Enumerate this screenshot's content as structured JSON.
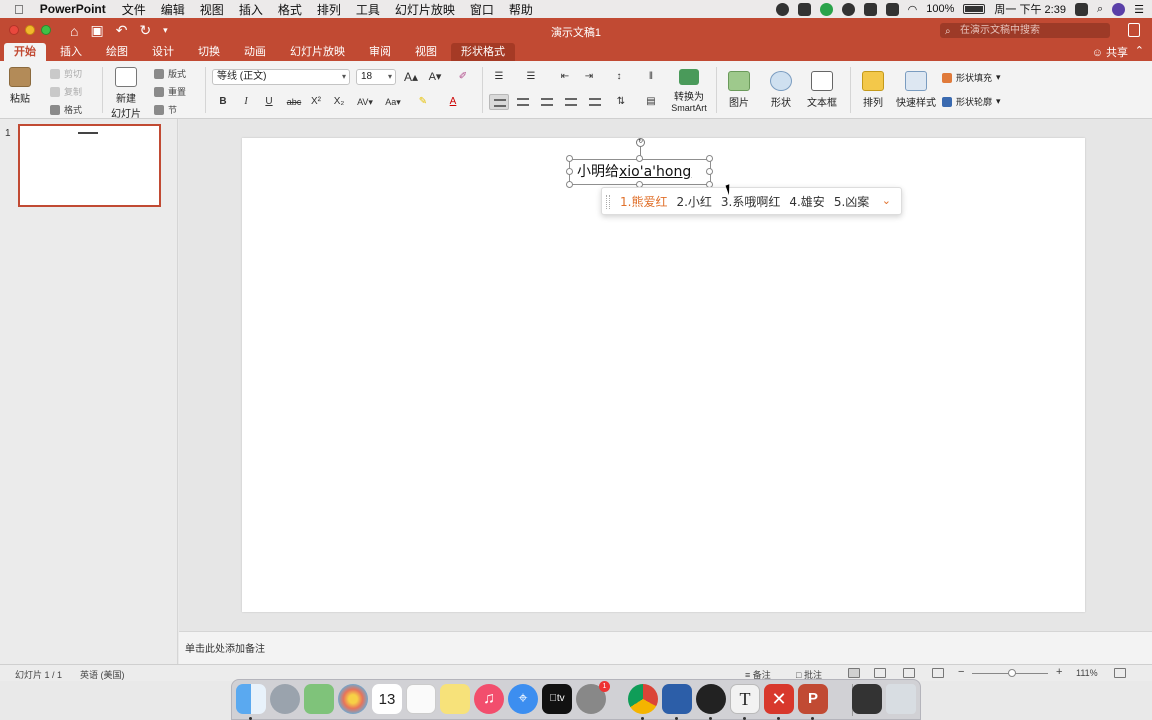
{
  "menubar": {
    "app_name": "PowerPoint",
    "items": [
      "文件",
      "编辑",
      "视图",
      "插入",
      "格式",
      "排列",
      "工具",
      "幻灯片放映",
      "窗口",
      "帮助"
    ],
    "battery": "100%",
    "clock": "周一 下午 2:39"
  },
  "titlebar": {
    "doc_title": "演示文稿1",
    "search_placeholder": "在演示文稿中搜索"
  },
  "tabs": {
    "items": [
      "开始",
      "插入",
      "绘图",
      "设计",
      "切换",
      "动画",
      "幻灯片放映",
      "审阅",
      "视图",
      "形状格式"
    ],
    "share": "共享"
  },
  "ribbon": {
    "paste": "粘贴",
    "cut": "剪切",
    "copy": "复制",
    "format_painter": "格式",
    "new_slide_line1": "新建",
    "new_slide_line2": "幻灯片",
    "layout": "版式",
    "reset": "重置",
    "section": "节",
    "font_name": "等线 (正文)",
    "font_size": "18",
    "bold": "B",
    "italic": "I",
    "underline": "U",
    "strike": "abc",
    "superscript": "X²",
    "subscript": "X₂",
    "convert_line1": "转换为",
    "convert_line2": "SmartArt",
    "picture": "图片",
    "shape": "形状",
    "textbox": "文本框",
    "arrange": "排列",
    "quick_styles": "快速样式",
    "shape_fill": "形状填充",
    "shape_outline": "形状轮廓"
  },
  "thumbnails": {
    "slide_number": "1"
  },
  "slide": {
    "text_committed": "小明给",
    "text_composing": "xio'a'hong"
  },
  "ime": {
    "candidates": [
      "1.熊爱红",
      "2.小红",
      "3.系哦啊红",
      "4.雄安",
      "5.凶案"
    ]
  },
  "notes": {
    "placeholder": "单击此处添加备注"
  },
  "statusbar": {
    "slide_info": "幻灯片 1 / 1",
    "language": "英语 (美国)",
    "notes": "备注",
    "comments": "批注",
    "zoom_minus": "−",
    "zoom_plus": "+",
    "zoom_level": "111%"
  },
  "dock": {
    "calendar_day": "13",
    "badge": "1",
    "apps": [
      "finder-icon",
      "launchpad-icon",
      "maps-icon",
      "photos-icon",
      "calendar-icon",
      "reminders-icon",
      "notes-icon",
      "music-icon",
      "safari-icon",
      "tv-icon",
      "system-preferences-icon",
      "chrome-icon",
      "virtualbox-icon",
      "obs-icon",
      "typora-icon",
      "xmind-icon",
      "powerpoint-icon",
      "downloads-icon",
      "trash-icon"
    ]
  },
  "colors": {
    "accent": "#c14a33",
    "ime_highlight": "#e0702b"
  }
}
